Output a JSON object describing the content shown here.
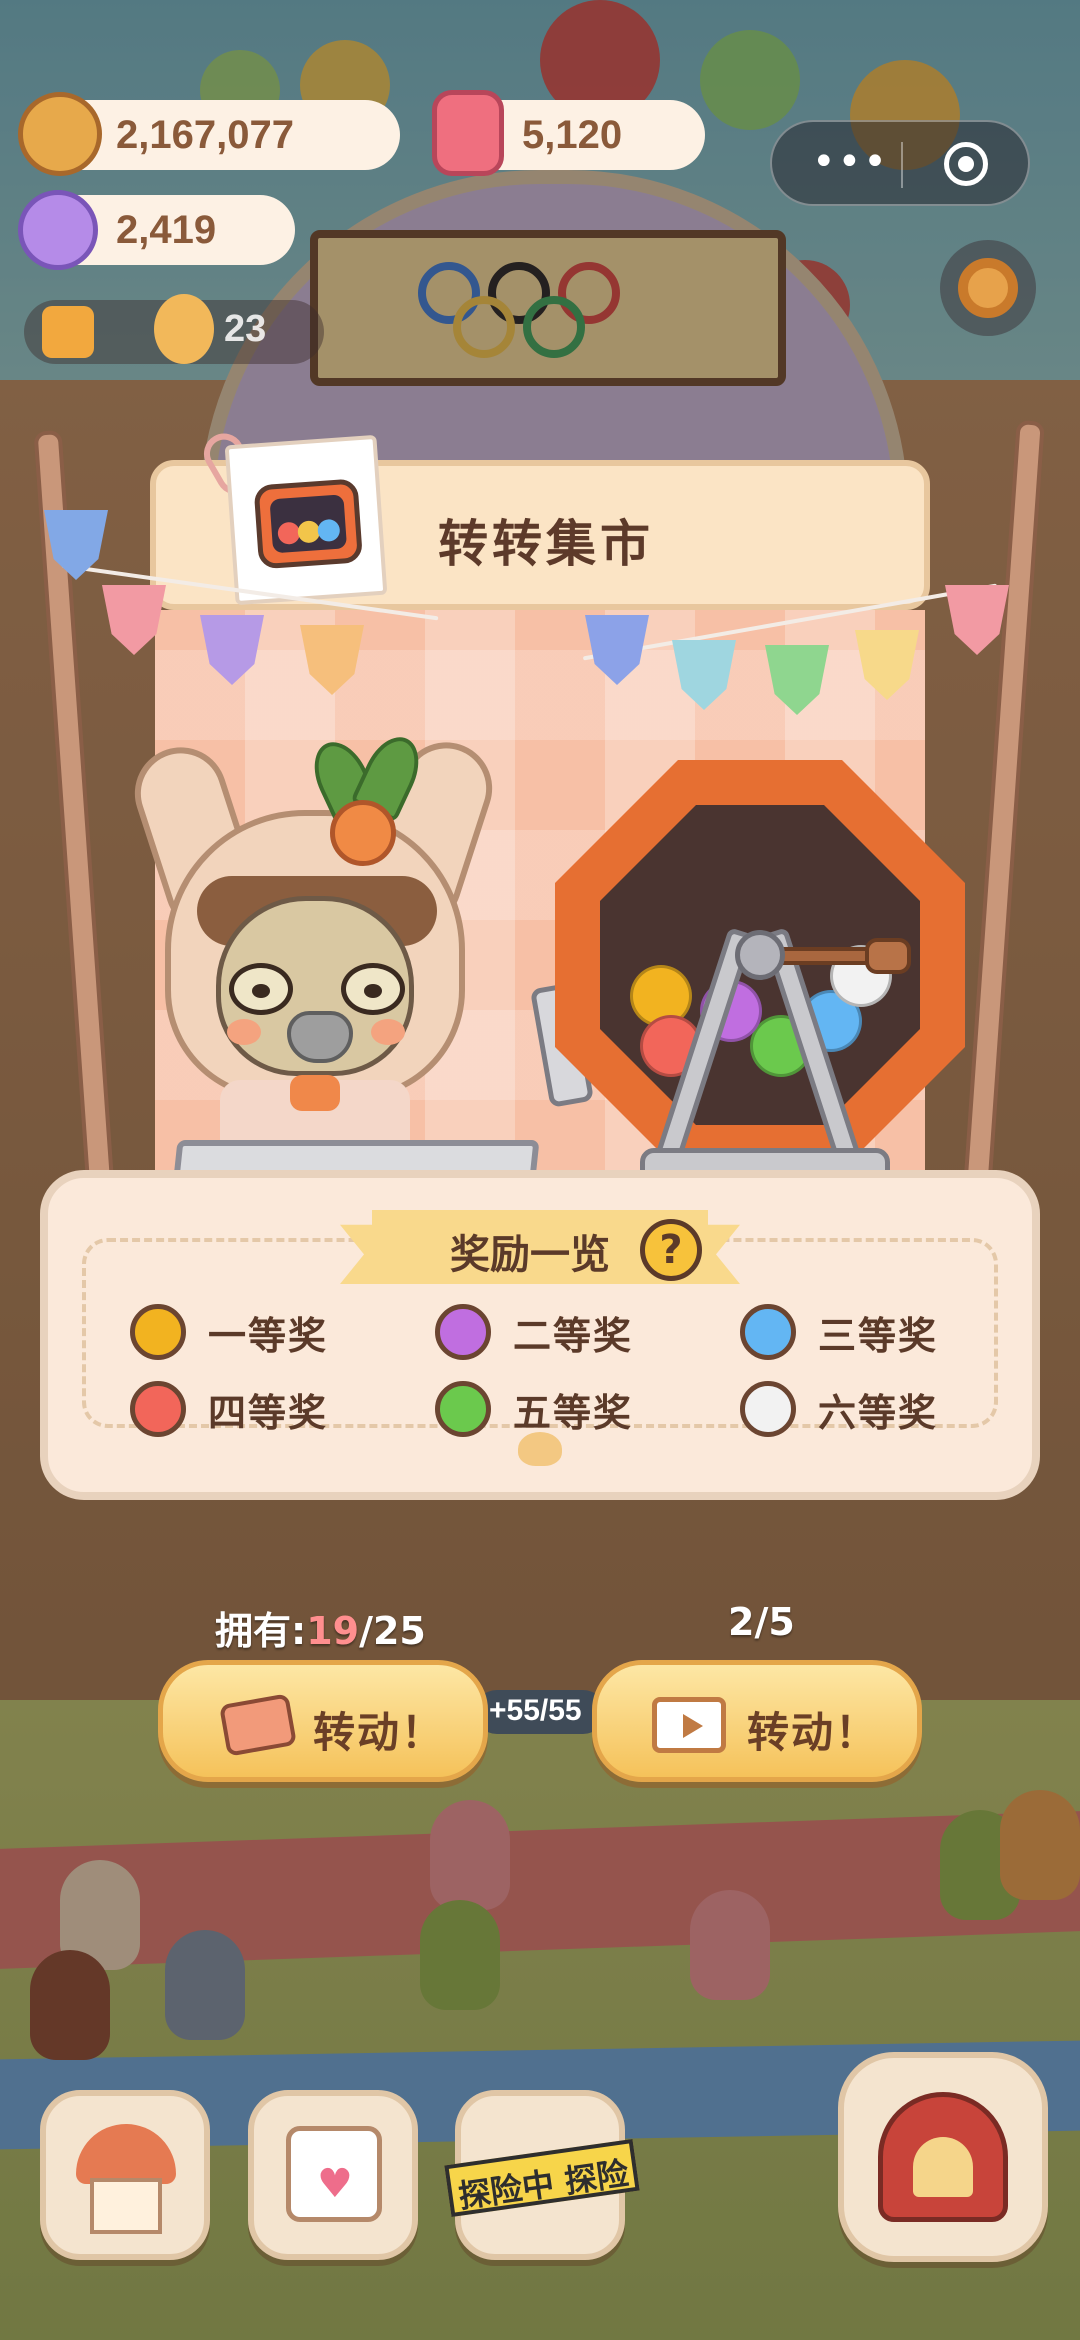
{
  "hud": {
    "coins": "2,167,077",
    "coins_icon": "cookie-coin-icon",
    "candles": "5,120",
    "candles_icon": "pink-candle-icon",
    "gems": "2,419",
    "gems_icon": "purple-candy-gem-icon",
    "notice_count": "23",
    "notice_icon": "megaphone-icon"
  },
  "wechat_capsule": {
    "menu_icon": "more-dots-icon",
    "close_icon": "target-close-icon"
  },
  "market": {
    "title": "转转集市",
    "title_icon": "retro-tv-icon",
    "rewards": {
      "heading": "奖励一览",
      "help_label": "?",
      "prizes": [
        {
          "label": "一等奖",
          "color": "#f2b320"
        },
        {
          "label": "二等奖",
          "color": "#c06ee0"
        },
        {
          "label": "三等奖",
          "color": "#63b6f3"
        },
        {
          "label": "四等奖",
          "color": "#f2665a"
        },
        {
          "label": "五等奖",
          "color": "#6bc94d"
        },
        {
          "label": "六等奖",
          "color": "#f2f2f2"
        }
      ]
    },
    "machine_balls": [
      "#f2b320",
      "#f2665a",
      "#6bc94d",
      "#63b6f3",
      "#f2f2f2",
      "#c06ee0"
    ]
  },
  "actions": {
    "owned_label": "拥有:",
    "owned_current": "19",
    "owned_total": "/25",
    "ad_count": "2/5",
    "ticket_spin_label": "转动！",
    "video_spin_label": "转动！",
    "energy": "+55/55"
  },
  "bottom_nav": {
    "explore_tape": "探险中 探险",
    "items": [
      "house-icon",
      "calendar-heart-icon",
      "explore-icon",
      "circus-stage-icon"
    ]
  },
  "colors": {
    "accent_orange": "#e66f32",
    "button_yellow": "#f5c25a",
    "text_brown": "#5b3a29"
  }
}
